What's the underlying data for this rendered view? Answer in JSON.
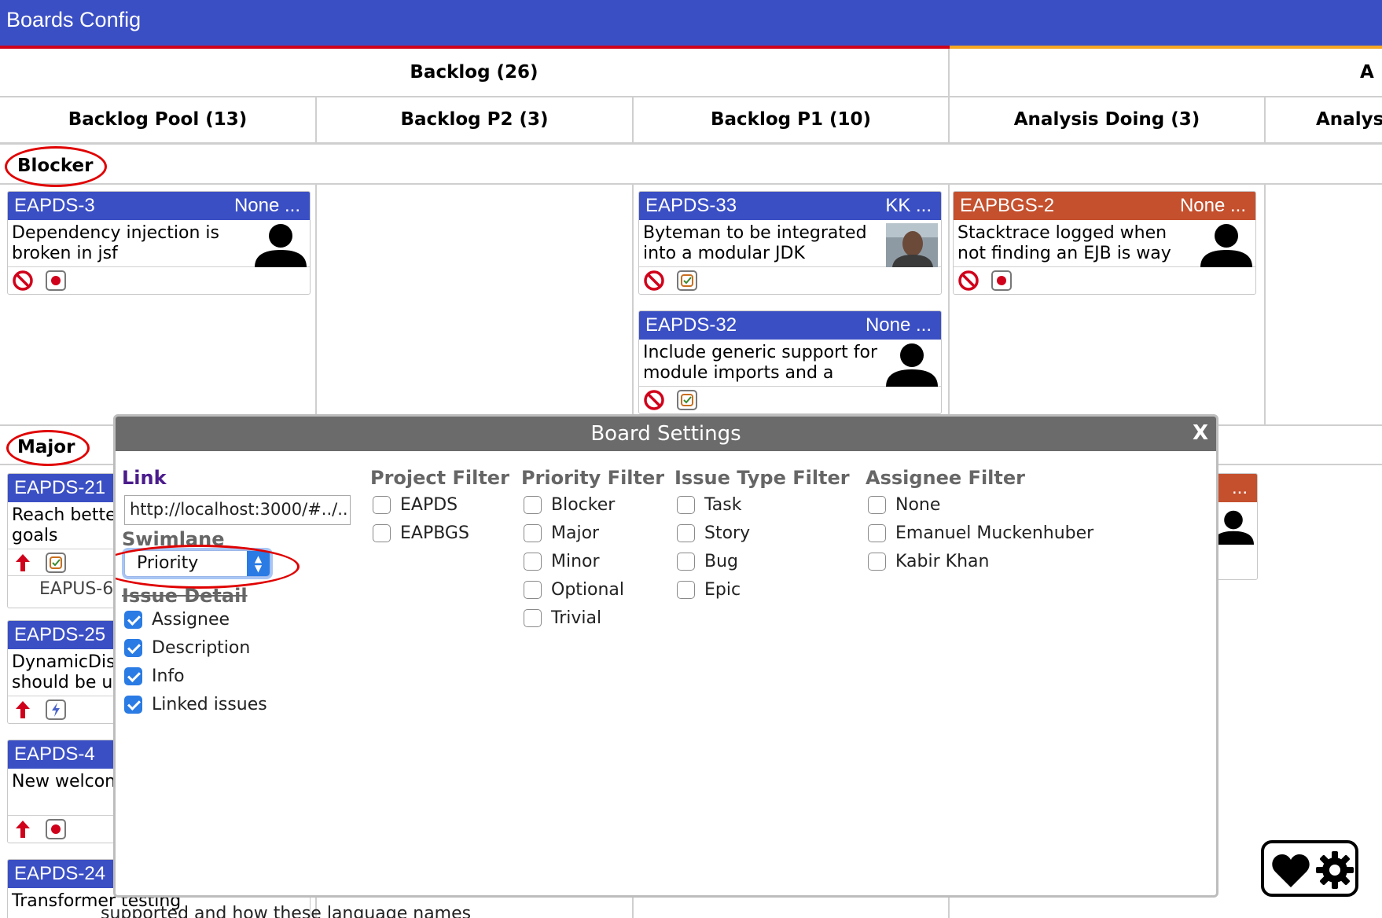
{
  "app": {
    "title": "Boards Config"
  },
  "board": {
    "group_headers": [
      {
        "label": "Backlog (26)"
      },
      {
        "label": "A"
      }
    ],
    "columns": [
      {
        "label": "Backlog Pool (13)"
      },
      {
        "label": "Backlog P2 (3)"
      },
      {
        "label": "Backlog P1 (10)"
      },
      {
        "label": "Analysis Doing (3)"
      },
      {
        "label": "Analys"
      }
    ],
    "swimlanes": [
      {
        "label": "Blocker"
      },
      {
        "label": "Major"
      }
    ],
    "cards": {
      "eapds3": {
        "id": "EAPDS-3",
        "assignee": "None ...",
        "summary_1": "Dependency injection is",
        "summary_2": "broken in jsf"
      },
      "eapds33": {
        "id": "EAPDS-33",
        "assignee": "KK ...",
        "summary_1": "Byteman to be integrated",
        "summary_2": "into a modular JDK"
      },
      "eapbgs2": {
        "id": "EAPBGS-2",
        "assignee": "None ...",
        "summary_1": "Stacktrace logged when",
        "summary_2": "not finding an EJB is way"
      },
      "eapds32": {
        "id": "EAPDS-32",
        "assignee": "None ...",
        "summary_1": "Include generic support for",
        "summary_2": "module imports and a"
      },
      "eapds21": {
        "id": "EAPDS-21",
        "summary_1": "Reach bette",
        "summary_2": "goals",
        "linked": "EAPUS-6"
      },
      "eapds25": {
        "id": "EAPDS-25",
        "summary_1": "DynamicDis",
        "summary_2": "should be u"
      },
      "eapds4": {
        "id": "EAPDS-4",
        "summary_1": "New welcon"
      },
      "eapds24": {
        "id": "EAPDS-24",
        "summary_1": "Transformer testing",
        "behind_text": "supported and how these language names"
      },
      "partial_right": {
        "assignee": "..."
      }
    }
  },
  "modal": {
    "title": "Board Settings",
    "close_label": "X",
    "link": {
      "title": "Link",
      "value": "http://localhost:3000/#../.."
    },
    "swimlane": {
      "title": "Swimlane",
      "selected": "Priority"
    },
    "issue_detail": {
      "title": "Issue Detail",
      "options": [
        {
          "label": "Assignee",
          "checked": true
        },
        {
          "label": "Description",
          "checked": true
        },
        {
          "label": "Info",
          "checked": true
        },
        {
          "label": "Linked issues",
          "checked": true
        }
      ]
    },
    "project_filter": {
      "title": "Project Filter",
      "options": [
        "EAPDS",
        "EAPBGS"
      ]
    },
    "priority_filter": {
      "title": "Priority Filter",
      "options": [
        "Blocker",
        "Major",
        "Minor",
        "Optional",
        "Trivial"
      ]
    },
    "issue_type_filter": {
      "title": "Issue Type Filter",
      "options": [
        "Task",
        "Story",
        "Bug",
        "Epic"
      ]
    },
    "assignee_filter": {
      "title": "Assignee Filter",
      "options": [
        "None",
        "Emanuel Muckenhuber",
        "Kabir Khan"
      ]
    }
  },
  "colors": {
    "header_blue": "#3b4fc4",
    "bug_card": "#c4502e",
    "annotation_red": "#e00000",
    "checkbox_blue": "#2a7be4"
  },
  "icons": {
    "blocker_priority": "no-entry-icon",
    "major_priority": "arrow-up-icon",
    "bug_type": "record-dot-icon",
    "task_type": "checkbox-icon",
    "epic_type": "lightning-icon",
    "person": "person-silhouette-icon",
    "favorite": "heart-icon",
    "settings": "gear-icon"
  }
}
